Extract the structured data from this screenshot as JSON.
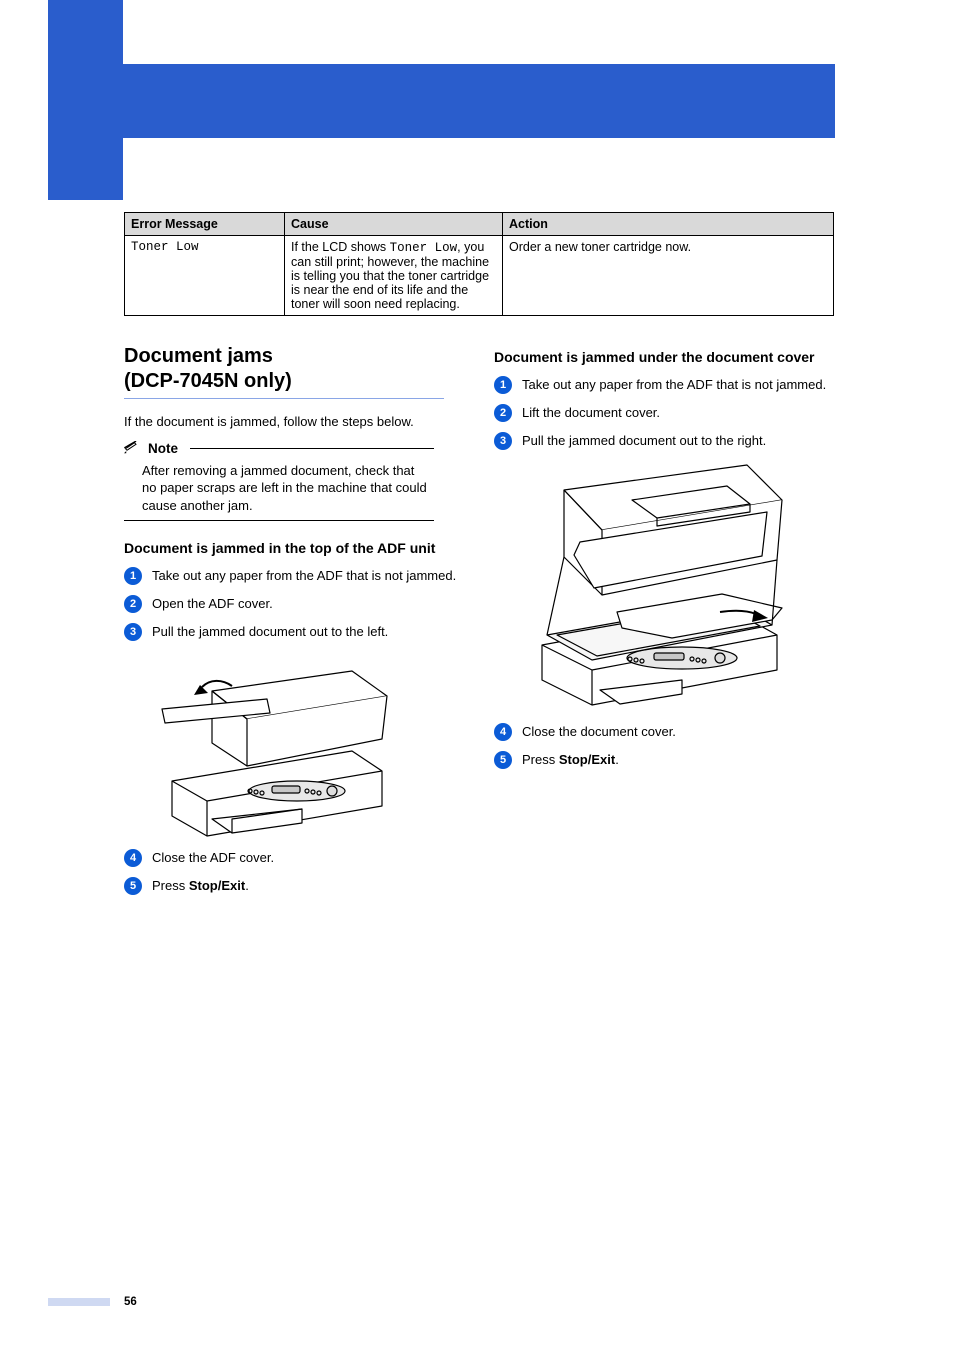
{
  "page_number": "56",
  "table": {
    "headers": [
      "Error Message",
      "Cause",
      "Action"
    ],
    "row": {
      "msg_mono": "Toner Low",
      "cause_prefix": "If the LCD shows ",
      "cause_mono": "Toner Low",
      "cause_suffix": ", you can still print; however, the machine is telling you that the toner cartridge is near the end of its life and the toner will soon need replacing.",
      "action": "Order a new toner cartridge now."
    }
  },
  "left": {
    "heading_l1": "Document jams",
    "heading_l2": "(DCP-7045N only)",
    "intro": "If the document is jammed, follow the steps below.",
    "note_label": "Note",
    "note_body": "After removing a jammed document, check that no paper scraps are left in the machine that could cause another jam.",
    "sub": "Document is jammed in the top of the ADF unit",
    "steps": {
      "s1": "Take out any paper from the ADF that is not jammed.",
      "s2": "Open the ADF cover.",
      "s3": "Pull the jammed document out to the left.",
      "s4": "Close the ADF cover.",
      "s5_pre": "Press ",
      "s5_strong": "Stop/Exit",
      "s5_post": "."
    }
  },
  "right": {
    "sub": "Document is jammed under the document cover",
    "steps": {
      "s1": "Take out any paper from the ADF that is not jammed.",
      "s2": "Lift the document cover.",
      "s3": "Pull the jammed document out to the right.",
      "s4": "Close the document cover.",
      "s5_pre": "Press ",
      "s5_strong": "Stop/Exit",
      "s5_post": "."
    }
  }
}
